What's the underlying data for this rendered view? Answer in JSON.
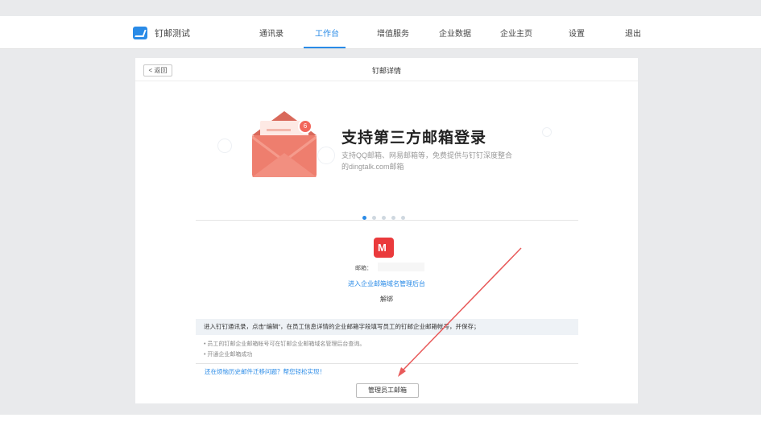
{
  "app": {
    "name": "钉邮测试"
  },
  "nav": {
    "items": [
      {
        "label": "通讯录"
      },
      {
        "label": "工作台"
      },
      {
        "label": "增值服务"
      },
      {
        "label": "企业数据"
      },
      {
        "label": "企业主页"
      },
      {
        "label": "设置"
      },
      {
        "label": "退出"
      }
    ],
    "active": "工作台"
  },
  "page": {
    "back_label": "< 返回",
    "title": "钉邮详情"
  },
  "hero": {
    "title": "支持第三方邮箱登录",
    "desc_line1": "支持QQ邮箱、网易邮箱等，免费提供与钉钉深度整合",
    "desc_line2": "的dingtalk.com邮箱",
    "badge": "6",
    "carousel_count": 5,
    "carousel_active": 0
  },
  "account": {
    "email_label": "邮箱：",
    "manage_link": "进入企业邮箱域名管理后台",
    "unbind": "解绑"
  },
  "instructions": {
    "info": "进入钉钉通讯录，点击“编辑”，在员工信息详情的企业邮箱字段填写员工的钉邮企业邮箱帐号，并保存；",
    "notes": [
      "• 员工的钉邮企业邮箱帐号可在钉邮企业邮箱域名管理后台查询。",
      "• 开通企业邮箱成功"
    ],
    "help_link": "还在烦恼历史邮件迁移问题？帮您轻松实现！",
    "button": "管理员工邮箱"
  },
  "colors": {
    "accent": "#2a8be7",
    "envelope": "#ee7e6e",
    "mail_icon": "#ea3a3c",
    "annotation_arrow": "#e85a5a"
  }
}
